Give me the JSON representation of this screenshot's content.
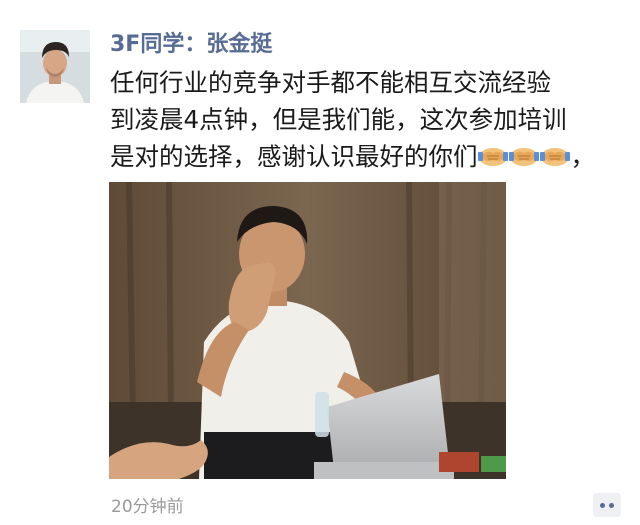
{
  "post": {
    "author": "3F同学：张金挺",
    "text_lines": [
      "任何行业的竞争对手都不能相互交流经验",
      "到凌晨4点钟，但是我们能，这次参加培训",
      "是对的选择，感谢认识最好的你们"
    ],
    "text_suffix": "，",
    "emoji": [
      "handshake-emoji",
      "handshake-emoji",
      "handshake-emoji"
    ],
    "timestamp": "20分钟前"
  },
  "icons": {
    "comment_button": "comment-more-icon"
  },
  "colors": {
    "author_name": "#576b95",
    "body_text": "#1a1a1a",
    "timestamp": "#9a9a9a",
    "comment_button_bg": "#eef0f4"
  }
}
